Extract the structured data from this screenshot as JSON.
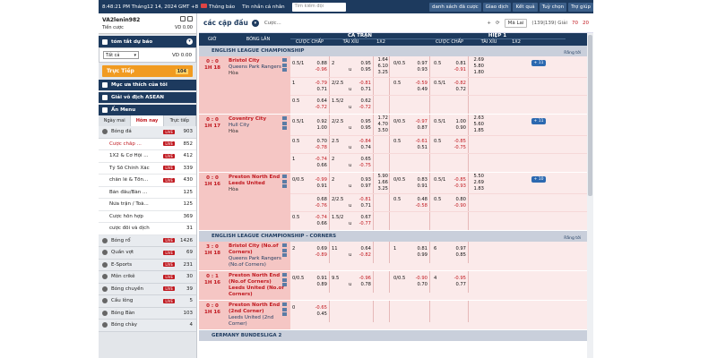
{
  "topbar": {
    "clock": "8:48:21 PM Tháng12 14, 2024 GMT +8",
    "notice": "Thông báo",
    "message": "Tin nhắn cá nhân",
    "search_placeholder": "Tìm kiếm đội",
    "links": [
      "danh sách đã cược",
      "Giao dịch",
      "Kết quả",
      "Tuỳ chọn",
      "Trợ giúp"
    ]
  },
  "account": {
    "username": "VA2lenin982",
    "balance_label": "Tiền cược",
    "balance_value": "VD 0.00"
  },
  "sidebar": {
    "summary_title": "tóm tắt dự báo",
    "select_value": "Tất cả",
    "select_balance": "VD 0.00",
    "live_label": "Trực Tiếp",
    "live_count": "104",
    "schedule_title": "Mục ưa thích của tôi",
    "asean_title": "Giải vô địch ASEAN",
    "menu_title": "Ẩn Menu",
    "tabs": [
      "Ngày mai",
      "Hôm nay",
      "Trực tiếp"
    ],
    "tab_active": 1,
    "sports_top": {
      "name": "Bóng đá",
      "live": "LIVE",
      "count": "903"
    },
    "sub_items": [
      {
        "name": "Cược chấp ...",
        "live": "LIVE",
        "count": "852",
        "on": true
      },
      {
        "name": "1X2 & Cơ Hội ...",
        "live": "LIVE",
        "count": "412"
      },
      {
        "name": "Tỷ Số Chính Xác",
        "live": "LIVE",
        "count": "339"
      },
      {
        "name": "chẵn lẻ & Tổn...",
        "live": "LIVE",
        "count": "430"
      },
      {
        "name": "Bàn đầu/Bàn ...",
        "live": "",
        "count": "125"
      },
      {
        "name": "Nửa trận / Toà...",
        "live": "",
        "count": "125"
      },
      {
        "name": "Cược hỗn hợp",
        "live": "",
        "count": "369"
      },
      {
        "name": "cược đối và dịch",
        "live": "",
        "count": "31"
      }
    ],
    "sports": [
      {
        "name": "Bóng rổ",
        "live": "LIVE",
        "count": "1426"
      },
      {
        "name": "Quần vợt",
        "live": "LIVE",
        "count": "69"
      },
      {
        "name": "E-Sports",
        "live": "LIVE",
        "count": "231"
      },
      {
        "name": "Môn crikê",
        "live": "LIVE",
        "count": "30"
      },
      {
        "name": "Bóng chuyền",
        "live": "LIVE",
        "count": "39"
      },
      {
        "name": "Cầu lông",
        "live": "LIVE",
        "count": "5"
      },
      {
        "name": "Bóng Bàn",
        "live": "",
        "count": "103"
      },
      {
        "name": "Bóng chày",
        "live": "",
        "count": "4"
      }
    ]
  },
  "filter": {
    "title": "các cặp đấu",
    "bet_label": "Cược...",
    "ctl_add": "+",
    "ctl_refresh": "⟳",
    "odds_type": "Mã Lai",
    "page_count": "(139|139) Giải",
    "badge1": "70",
    "badge2": "20"
  },
  "headers": {
    "time": "GIỜ",
    "match": "BÓNG LĂN",
    "full": "CẢ TRẬN",
    "half": "HIỆP 1",
    "hdp": "CƯỢC CHẤP",
    "ou": "TÀI XỈU",
    "x12": "1X2"
  },
  "leagues": [
    {
      "name": "ENGLISH LEAGUE CHAMPIONSHIP",
      "link": "Rằng tới",
      "matches": [
        {
          "score": "0 : 0",
          "time": "1H 18",
          "home": "Bristol City",
          "away": "Queens Park Rangers",
          "draw": "Hòa",
          "away_red": false,
          "more": "+ 11",
          "rows": [
            {
              "hl": "0.5/1",
              "ho": [
                "0.88",
                "-0.96"
              ],
              "ol": "2",
              "ou": "u",
              "oo": [
                "0.95",
                "0.95"
              ],
              "x": [
                "1.64",
                "6.10",
                "3.25"
              ],
              "h1l": "0/0.5",
              "h1o": [
                "0.97",
                "0.93"
              ],
              "h1ol": "0.5",
              "h1oo": [
                "0.81",
                "-0.91"
              ],
              "h1x": [
                "2.69",
                "5.80",
                "1.80"
              ]
            },
            {
              "hl": "1",
              "ho": [
                "-0.79",
                "0.71"
              ],
              "ol": "2/2.5",
              "ou": "u",
              "oo": [
                "-0.81",
                "0.71"
              ],
              "x": [
                "",
                "",
                ""
              ],
              "h1l": "0.5",
              "h1o": [
                "-0.59",
                "0.49"
              ],
              "h1ol": "0.5/1",
              "h1oo": [
                "-0.82",
                "0.72"
              ],
              "h1x": [
                "",
                "",
                ""
              ]
            },
            {
              "hl": "0.5",
              "ho": [
                "0.64",
                "-0.72"
              ],
              "ol": "1.5/2",
              "ou": "u",
              "oo": [
                "0.62",
                "-0.72"
              ],
              "x": [
                "",
                "",
                ""
              ],
              "h1l": "",
              "h1o": [
                "",
                ""
              ],
              "h1ol": "",
              "h1oo": [
                "",
                ""
              ],
              "h1x": [
                "",
                "",
                ""
              ]
            }
          ]
        },
        {
          "score": "0 : 0",
          "time": "1H 17",
          "home": "Coventry City",
          "away": "Hull City",
          "draw": "Hòa",
          "away_red": false,
          "more": "+ 11",
          "rows": [
            {
              "hl": "0.5/1",
              "ho": [
                "0.92",
                "1.00"
              ],
              "ol": "2/2.5",
              "ou": "u",
              "oo": [
                "0.95",
                "0.95"
              ],
              "x": [
                "1.72",
                "4.70",
                "3.50"
              ],
              "h1l": "0/0.5",
              "h1o": [
                "-0.97",
                "0.87"
              ],
              "h1ol": "0.5/1",
              "h1oo": [
                "1.00",
                "0.90"
              ],
              "h1x": [
                "2.63",
                "5.60",
                "1.85"
              ]
            },
            {
              "hl": "0.5",
              "ho": [
                "0.70",
                "-0.78"
              ],
              "ol": "2.5",
              "ou": "u",
              "oo": [
                "-0.84",
                "0.74"
              ],
              "x": [
                "",
                "",
                ""
              ],
              "h1l": "0.5",
              "h1o": [
                "-0.61",
                "0.51"
              ],
              "h1ol": "0.5",
              "h1oo": [
                "-0.85",
                "-0.75"
              ],
              "h1x": [
                "",
                "",
                ""
              ]
            },
            {
              "hl": "1",
              "ho": [
                "-0.74",
                "0.66"
              ],
              "ol": "2",
              "ou": "u",
              "oo": [
                "0.65",
                "-0.75"
              ],
              "x": [
                "",
                "",
                ""
              ],
              "h1l": "",
              "h1o": [
                "",
                ""
              ],
              "h1ol": "",
              "h1oo": [
                "",
                ""
              ],
              "h1x": [
                "",
                "",
                ""
              ]
            }
          ]
        },
        {
          "score": "0 : 0",
          "time": "1H 16",
          "home": "Preston North End",
          "away": "Leeds United",
          "draw": "Hòa",
          "away_red": true,
          "more": "+ 10",
          "rows": [
            {
              "hl": "0/0.5",
              "ho": [
                "-0.99",
                "0.91"
              ],
              "ol": "2",
              "ou": "u",
              "oo": [
                "0.93",
                "0.97"
              ],
              "x": [
                "5.90",
                "1.66",
                "3.25"
              ],
              "h1l": "0/0.5",
              "h1o": [
                "0.83",
                "0.91"
              ],
              "h1ol": "0.5/1",
              "h1oo": [
                "-0.85",
                "-0.93"
              ],
              "h1x": [
                "5.50",
                "2.69",
                "1.83"
              ]
            },
            {
              "hl": "",
              "ho": [
                "0.68",
                "-0.76"
              ],
              "ol": "2/2.5",
              "ou": "u",
              "oo": [
                "-0.81",
                "0.71"
              ],
              "x": [
                "",
                "",
                ""
              ],
              "h1l": "0.5",
              "h1o": [
                "0.48",
                "-0.58"
              ],
              "h1ol": "0.5",
              "h1oo": [
                "0.80",
                "-0.90"
              ],
              "h1x": [
                "",
                "",
                ""
              ]
            },
            {
              "hl": "0.5",
              "ho": [
                "-0.74",
                "0.66"
              ],
              "ol": "1.5/2",
              "ou": "u",
              "oo": [
                "0.67",
                "-0.77"
              ],
              "x": [
                "",
                "",
                ""
              ],
              "h1l": "",
              "h1o": [
                "",
                ""
              ],
              "h1ol": "",
              "h1oo": [
                "",
                ""
              ],
              "h1x": [
                "",
                "",
                ""
              ]
            }
          ]
        }
      ]
    },
    {
      "name": "ENGLISH LEAGUE CHAMPIONSHIP - CORNERS",
      "link": "Rằng tới",
      "matches": [
        {
          "score": "3 : 0",
          "time": "1H 18",
          "home": "Bristol City (No.of Corners)",
          "away": "Queens Park Rangers (No.of Corners)",
          "draw": "",
          "away_red": false,
          "more": "",
          "rows": [
            {
              "hl": "2",
              "ho": [
                "0.69",
                "-0.89"
              ],
              "ol": "11",
              "ou": "u",
              "oo": [
                "0.64",
                "-0.82"
              ],
              "x": [
                "",
                "",
                ""
              ],
              "h1l": "1",
              "h1o": [
                "0.81",
                "0.99"
              ],
              "h1ol": "6",
              "h1oo": [
                "0.97",
                "0.85"
              ],
              "h1x": [
                "",
                "",
                ""
              ]
            }
          ]
        },
        {
          "score": "0 : 1",
          "time": "1H 16",
          "home": "Preston North End (No.of Corners)",
          "away": "Leeds United (No.of Corners)",
          "draw": "",
          "away_red": true,
          "more": "",
          "rows": [
            {
              "hl": "0/0.5",
              "ho": [
                "0.91",
                "0.89"
              ],
              "ol": "9.5",
              "ou": "u",
              "oo": [
                "-0.96",
                "0.78"
              ],
              "x": [
                "",
                "",
                ""
              ],
              "h1l": "0/0.5",
              "h1o": [
                "-0.90",
                "0.70"
              ],
              "h1ol": "4",
              "h1oo": [
                "-0.95",
                "0.77"
              ],
              "h1x": [
                "",
                "",
                ""
              ]
            }
          ]
        },
        {
          "score": "0 : 0",
          "time": "1H 16",
          "home": "Preston North End (2nd Corner)",
          "away": "Leeds United (2nd Corner)",
          "draw": "",
          "away_red": false,
          "more": "",
          "rows": [
            {
              "hl": "0",
              "ho": [
                "-0.65",
                "0.45"
              ],
              "ol": "",
              "ou": "",
              "oo": [
                "",
                ""
              ],
              "x": [
                "",
                "",
                ""
              ],
              "h1l": "",
              "h1o": [
                "",
                ""
              ],
              "h1ol": "",
              "h1oo": [
                "",
                ""
              ],
              "h1x": [
                "",
                "",
                ""
              ]
            }
          ]
        }
      ]
    },
    {
      "name": "GERMANY BUNDESLIGA 2",
      "link": "",
      "matches": []
    }
  ],
  "colors": {
    "navy": "#1d3a5e",
    "red": "#c0181f",
    "pink": "#f5c6c4",
    "orange": "#f19b21"
  }
}
